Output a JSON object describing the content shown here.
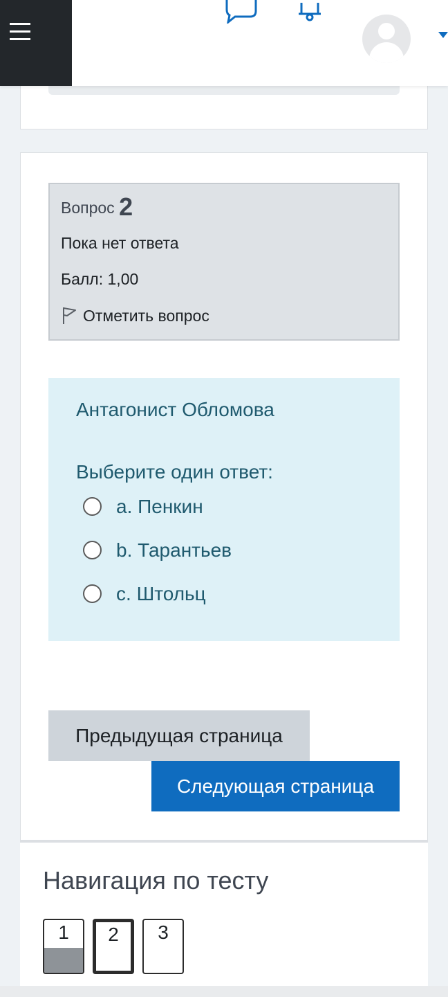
{
  "header": {
    "menu_icon": "hamburger-menu-icon",
    "messages_icon": "speech-bubble-icon",
    "notifications_icon": "bell-icon",
    "avatar_icon": "user-avatar-icon",
    "user_menu_icon": "caret-down-icon",
    "accent_color": "#0f6cbf"
  },
  "question": {
    "label": "Вопрос",
    "number": "2",
    "state": "Пока нет ответа",
    "grade": "Балл: 1,00",
    "flag_label": "Отметить вопрос",
    "flag_icon": "flag-icon",
    "text": "Антагонист Обломова",
    "prompt": "Выберите один ответ:",
    "answers": [
      {
        "letter": "a.",
        "text": "Пенкин",
        "selected": false
      },
      {
        "letter": "b.",
        "text": "Тарантьев",
        "selected": false
      },
      {
        "letter": "c.",
        "text": "Штольц",
        "selected": false
      }
    ]
  },
  "buttons": {
    "prev_page": "Предыдущая страница",
    "next_page": "Следующая страница"
  },
  "quiz_nav": {
    "title": "Навигация по тесту",
    "items": [
      {
        "label": "1",
        "state": "answered"
      },
      {
        "label": "2",
        "state": "current"
      },
      {
        "label": "3",
        "state": "not-yet-answered"
      }
    ]
  }
}
